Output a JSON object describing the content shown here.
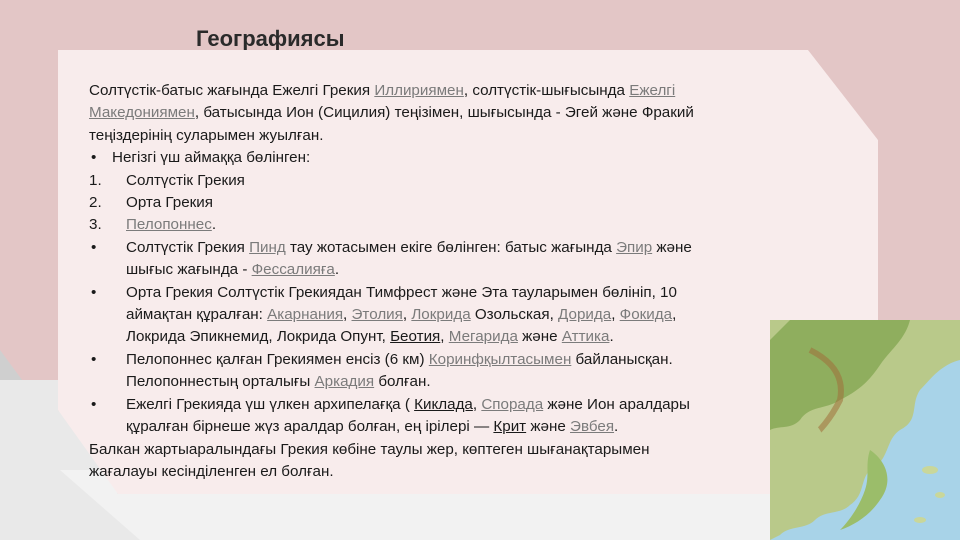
{
  "title": "Географиясы",
  "paragraph1": {
    "t1": "Солтүстік-батыс жағында Ежелгі Грекия ",
    "l1": "Иллириямен",
    "t2": ", солтүстік-шығысында ",
    "l2a": "Ежелгі",
    "l2b": "Македониямен",
    "t3": ", батысында Ион (Сицилия) теңізімен, шығысында - Эгей және Фракий",
    "t4": "теңіздерінің суларымен жуылған."
  },
  "bullet_main": "Негізгі үш аймаққа бөлінген:",
  "regions": [
    {
      "num": "1.",
      "text": "Солтүстік Грекия"
    },
    {
      "num": "2.",
      "text": "Орта Грекия"
    },
    {
      "num": "3.",
      "link": "Пелопоннес",
      "after": "."
    }
  ],
  "b1": {
    "t1": "Солтүстік Грекия ",
    "l1": "Пинд",
    "t2": " тау жотасымен екіге бөлінген: батыс жағында ",
    "l2": "Эпир",
    "t3": " және",
    "t4": "шығыс жағында - ",
    "l3": "Фессалияға",
    "t5": "."
  },
  "b2": {
    "t1": " Орта Грекия Солтүстік Грекиядан Тимфрест және Эта тауларымен бөлініп, 10",
    "t2": "аймақтан құралған: ",
    "l1": "Акарнания",
    "c1": ", ",
    "l2": "Этолия",
    "c2": ", ",
    "l3": "Локрида",
    "t3": " Озольская, ",
    "l4": "Дорида",
    "c3": ", ",
    "l5": "Фокида",
    "c4": ",",
    "t4": "Локрида Эпикнемид, Локрида Опунт, ",
    "l6": "Беотия",
    "c5": ", ",
    "l7": "Мегарида",
    "t5": " және ",
    "l8": "Аттика",
    "t6": "."
  },
  "b3": {
    "t1": "Пелопоннес қалған Грекиямен енсіз (6 км) ",
    "l1": "Коринфқылтасымен",
    "t2": " байланысқан.",
    "t3": "Пелопоннестың орталығы ",
    "l2": "Аркадия",
    "t4": " болған."
  },
  "b4": {
    "t1": "Ежелгі Грекияда үш үлкен архипелағқа ( ",
    "l1": "Киклада",
    "c1": ", ",
    "l2": "Спорада",
    "t2": " және Ион аралдары",
    "t3": "құралған бірнеше жүз аралдар болған, ең ірілері — ",
    "l3": "Крит",
    "t4": " және ",
    "l4": "Эвбея",
    "t5": "."
  },
  "closing": {
    "t1": "Балкан жартыаралындағы Грекия көбіне таулы жер, көптеген шығанақтарымен",
    "t2": "жағалауы кесінділенген ел болған."
  },
  "bullet_char": "•",
  "colors": {
    "background": "#e3c6c6",
    "card": "#f8ecec",
    "link": "#7b7b7b",
    "sea": "#a8d3e8"
  }
}
